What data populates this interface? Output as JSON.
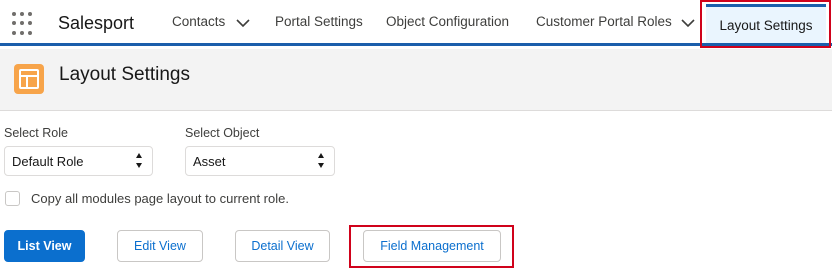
{
  "app": {
    "name": "Salesport"
  },
  "nav": {
    "items": [
      {
        "label": "Contacts"
      },
      {
        "label": "Portal Settings"
      },
      {
        "label": "Object Configuration"
      },
      {
        "label": "Customer Portal Roles"
      },
      {
        "label": "Layout Settings"
      }
    ],
    "active": "Layout Settings"
  },
  "page": {
    "title": "Layout Settings",
    "icon": "layout-icon"
  },
  "form": {
    "role": {
      "label": "Select Role",
      "value": "Default Role"
    },
    "object": {
      "label": "Select Object",
      "value": "Asset"
    },
    "copy_checkbox": {
      "label": "Copy all modules page layout to current role.",
      "checked": false
    }
  },
  "buttons": {
    "list_view": "List View",
    "edit_view": "Edit View",
    "detail_view": "Detail View",
    "field_management": "Field Management"
  },
  "colors": {
    "brand": "#0b6fce",
    "highlight": "#d0021b",
    "icon": "#f7a44a"
  }
}
